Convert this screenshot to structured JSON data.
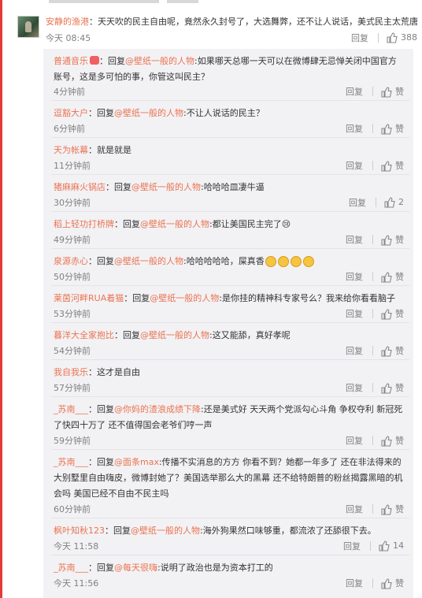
{
  "main_comment": {
    "user": "安静的渔港",
    "colon": "：",
    "text": "天天吹的民主自由呢，竟然永久封号了，大选舞弊，还不让人说话，美式民主太荒唐",
    "time": "今天 08:45",
    "reply_label": "回复",
    "likes": "388"
  },
  "replies": [
    {
      "user": "普通音乐",
      "prefix": "：回复",
      "target": "@壁纸一般的人物",
      "text": ":如果哪天总哪一天可以在微博肆无忌惮关闭中国官方账号，这是多可怕的事，你管这叫民主？",
      "time": "4分钟前",
      "reply_label": "回复",
      "like_label": "赞"
    },
    {
      "user": "逗豁大户",
      "prefix": "：回复",
      "target": "@壁纸一般的人物",
      "text": ":不让人说话的民主？",
      "time": "6分钟前",
      "reply_label": "回复",
      "like_label": "赞"
    },
    {
      "user": "天为帐幕",
      "prefix": "：",
      "target": "",
      "text": "就是就是",
      "time": "11分钟前",
      "reply_label": "回复",
      "like_label": "赞"
    },
    {
      "user": "猪麻麻火锅店",
      "prefix": "：回复",
      "target": "@壁纸一般的人物",
      "text": ":哈哈哈皿凄牛逼",
      "time": "30分钟前",
      "reply_label": "回复",
      "like_label": "2"
    },
    {
      "user": "稻上轻功打桥牌",
      "prefix": "：回复",
      "target": "@壁纸一般的人物",
      "text": ":都让美国民主完了😢",
      "time": "49分钟前",
      "reply_label": "回复",
      "like_label": "赞"
    },
    {
      "user": "泉源赤心",
      "prefix": "：回复",
      "target": "@壁纸一般的人物",
      "text": ":哈哈哈哈哈，屎真香",
      "time": "50分钟前",
      "reply_label": "回复",
      "like_label": "赞"
    },
    {
      "user": "莱茵河畔RUA着猫",
      "prefix": "：回复",
      "target": "@壁纸一般的人物",
      "text": ":是你挂的精神科专家号么？我来给你看看脑子",
      "time": "53分钟前",
      "reply_label": "回复",
      "like_label": "赞"
    },
    {
      "user": "暮洋大全家抱比",
      "prefix": "：回复",
      "target": "@壁纸一般的人物",
      "text": ":这又能舔，真好孝呢",
      "time": "54分钟前",
      "reply_label": "回复",
      "like_label": "赞"
    },
    {
      "user": "我自我乐",
      "prefix": "：",
      "target": "",
      "text": "这才是自由",
      "time": "57分钟前",
      "reply_label": "回复",
      "like_label": "赞"
    },
    {
      "user": "_苏南___",
      "prefix": "：回复",
      "target": "@你妈的渣浪成绩下降",
      "text": ":还是美式好 天天两个党派勾心斗角 争权夺利  新冠死了快四十万了 还不值得国会老爷们哼一声",
      "time": "59分钟前",
      "reply_label": "回复",
      "like_label": "赞"
    },
    {
      "user": "_苏南___",
      "prefix": "：回复",
      "target": "@面条max",
      "text": ":传播不实消息的方方 你看不到？她都一年多了 还在非法得来的大别墅里自由嗨皮，微博封她了？美国选举那么大的黑幕 还不给特朗普的粉丝揭露黑暗的机会吗 美国已经不自由不民主吗",
      "time": "60分钟前",
      "reply_label": "回复",
      "like_label": "赞"
    },
    {
      "user": "枫叶知秋123",
      "prefix": "：回复",
      "target": "@壁纸一般的人物",
      "text": ":海外狗果然口味够重，都流浓了还舔很下去。",
      "time": "今天 11:58",
      "reply_label": "回复",
      "like_label": "14"
    },
    {
      "user": "_苏南___",
      "prefix": "：回复",
      "target": "@每天很嗨",
      "text": ":说明了政治也是为资本打工的",
      "time": "今天 11:56",
      "reply_label": "回复",
      "like_label": "赞"
    }
  ],
  "colors": {
    "accent": "#eb7350",
    "panel": "#f2f2f5",
    "strip": "#e23b3b"
  },
  "icons": {
    "like": "thumbs-up-icon",
    "emoji": "smile-emoji-icon",
    "badge": "heart-badge-icon"
  }
}
